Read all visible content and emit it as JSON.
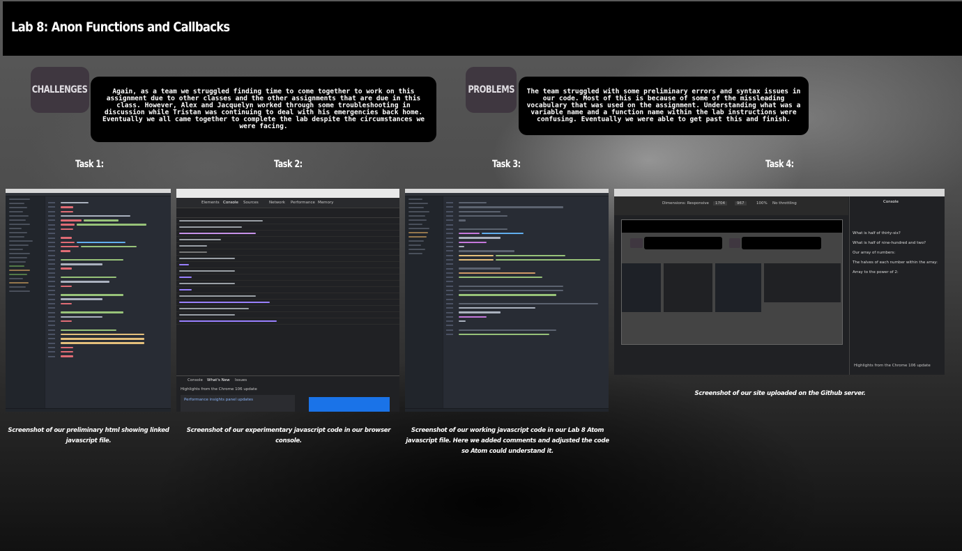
{
  "header": {
    "title": "Lab 8: Anon Functions and Callbacks"
  },
  "sections": {
    "challenges": {
      "heading": "CHALLENGES",
      "text": "Again, as a team we struggled finding time to come together to work on this assignment due to other classes and the other assignments that are due in this class. However, Alex and Jacquelyn worked through some troubleshooting in discussion while Tristan was continuing to deal with his emergencies back home. Eventually we all came together to complete the lab despite the circumstances we were facing."
    },
    "problems": {
      "heading": "PROBLEMS",
      "text": "The team struggled with some preliminary errors and syntax issues in our code. Most of this is because of some of the missleading vocabulary that was used on the assignment. Understanding what was a variable name and a function name within the lab instructions were confusing. Eventually we were able to get past this and finish."
    }
  },
  "tasks": [
    {
      "heading": "Task 1:",
      "caption": "Screenshot of our preliminary html showing linked javascript file."
    },
    {
      "heading": "Task 2:",
      "caption": "Screenshot of our experimentary javascript code in our browser console."
    },
    {
      "heading": "Task 3:",
      "caption": "Screenshot of our working javascript code in our Lab 8 Atom javascript file. Here we added comments and adjusted the code so Atom could understand it."
    },
    {
      "heading": "Task 4:",
      "caption": "Screenshot of our site uploaded on the Github server."
    }
  ],
  "screenshots": {
    "task2": {
      "tabs": [
        "Elements",
        "Console",
        "Sources",
        "Network",
        "Performance",
        "Memory"
      ],
      "drawer_tabs": [
        "Console",
        "What's New",
        "Issues"
      ],
      "drawer_text": "Highlights from the Chrome 106 update",
      "drawer_card_title": "Performance insights panel updates"
    },
    "task4": {
      "device_label": "Dimensions: Responsive",
      "width_value": "1704",
      "height_value": "967",
      "zoom_label": "100%",
      "throttle_label": "No throttling",
      "console_tab": "Console",
      "drawer_text": "Highlights from the Chrome 106 update",
      "log_lines": [
        "What is half of thirty-six?",
        "What is half of nine-hundred and two?",
        "Our array of numbers:",
        "The halves of each number within the array:",
        "Array to the power of 2:"
      ]
    }
  },
  "colors": {
    "header_bg": "#000000",
    "badge_bg": "#3f3740",
    "textbox_bg": "#000000"
  }
}
